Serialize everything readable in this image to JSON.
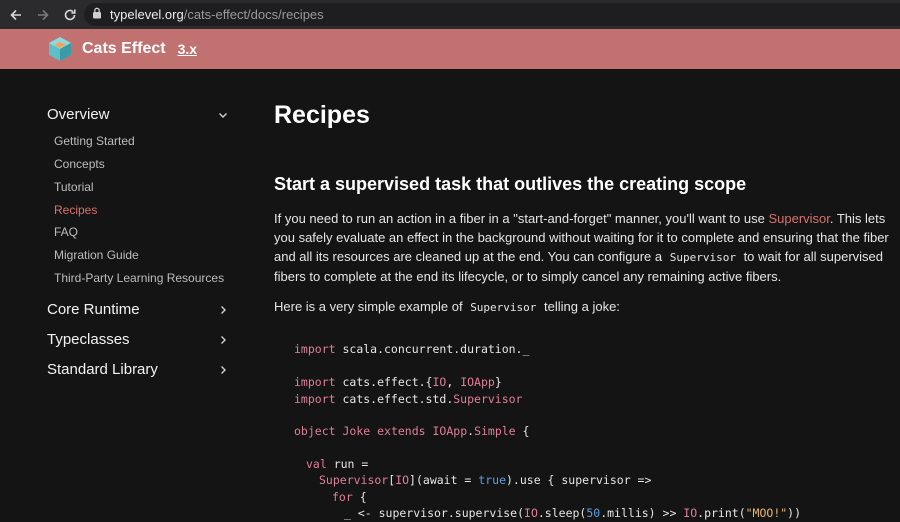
{
  "browser": {
    "url_host": "typelevel.org",
    "url_path": "/cats-effect/docs/recipes"
  },
  "header": {
    "title": "Cats Effect",
    "version": "3.x"
  },
  "sidebar": {
    "sections": [
      {
        "label": "Overview",
        "expanded": true
      },
      {
        "label": "Core Runtime",
        "expanded": false
      },
      {
        "label": "Typeclasses",
        "expanded": false
      },
      {
        "label": "Standard Library",
        "expanded": false
      }
    ],
    "overview_items": [
      {
        "label": "Getting Started"
      },
      {
        "label": "Concepts"
      },
      {
        "label": "Tutorial"
      },
      {
        "label": "Recipes",
        "active": true
      },
      {
        "label": "FAQ"
      },
      {
        "label": "Migration Guide"
      },
      {
        "label": "Third-Party Learning Resources"
      }
    ]
  },
  "main": {
    "title": "Recipes",
    "section_heading": "Start a supervised task that outlives the creating scope",
    "p1": {
      "t1": "If you need to run an action in a fiber in a \"start-and-forget\" manner, you'll want to use ",
      "link": "Supervisor",
      "t2": ". This lets you safely evaluate an effect in the background without waiting for it to complete and ensuring that the fiber and all its resources are cleaned up at the end. You can configure a ",
      "code": "Supervisor",
      "t3": " to wait for all supervised fibers to complete at the end its lifecycle, or to simply cancel any remaining active fibers."
    },
    "p2": {
      "t1": "Here is a very simple example of ",
      "code": "Supervisor",
      "t2": " telling a joke:"
    },
    "code": {
      "l1_kw": "import",
      "l1_rest": " scala.concurrent.duration._",
      "l2_kw": "import",
      "l2_a": " cats.effect.{",
      "l2_t1": "IO",
      "l2_b": ", ",
      "l2_t2": "IOApp",
      "l2_c": "}",
      "l3_kw": "import",
      "l3_a": " cats.effect.std.",
      "l3_t": "Supervisor",
      "l4_kw1": "object",
      "l4_sp": " ",
      "l4_t1": "Joke",
      "l4_kw2": " extends ",
      "l4_t2": "IOApp",
      "l4_a": ".",
      "l4_t3": "Simple",
      "l4_b": " {",
      "l5_kw": "val",
      "l5_rest": " run =",
      "l6_t1": "Supervisor",
      "l6_a": "[",
      "l6_t2": "IO",
      "l6_b": "](await = ",
      "l6_lit": "true",
      "l6_c": ").use { supervisor =>",
      "l7_kw": "for",
      "l7_rest": " {",
      "l8_a": "_ <- supervisor.supervise(",
      "l8_t1": "IO",
      "l8_b": ".sleep(",
      "l8_lit": "50",
      "l8_c": ".millis) >> ",
      "l8_t2": "IO",
      "l8_d": ".print(",
      "l8_str": "\"MOO!\"",
      "l8_e": "))"
    }
  }
}
